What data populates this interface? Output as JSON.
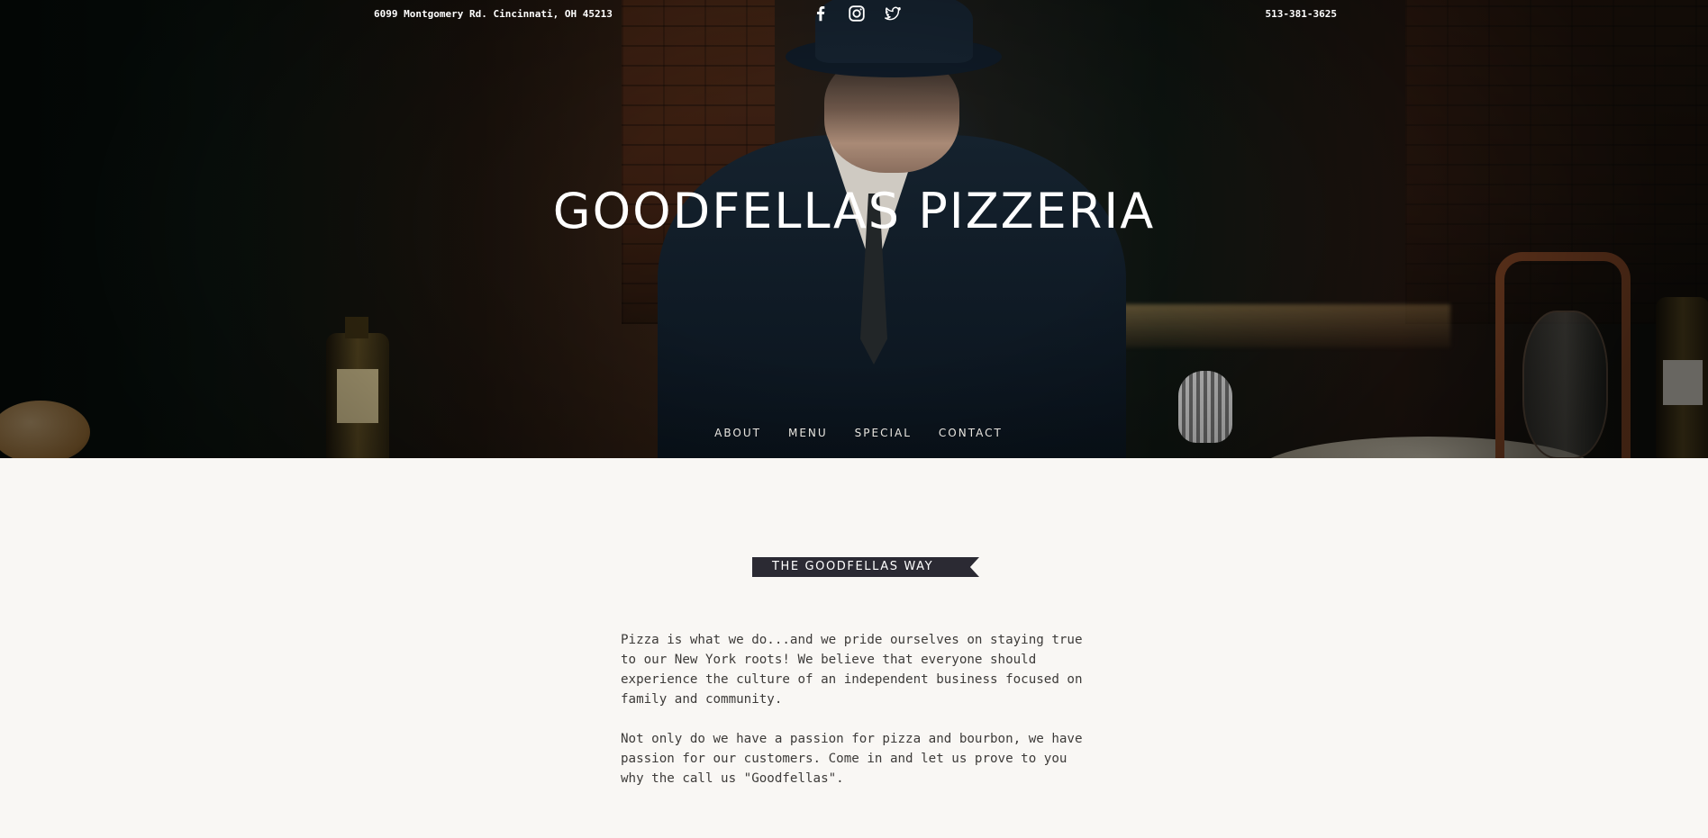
{
  "topbar": {
    "address": "6099 Montgomery Rd. Cincinnati, OH 45213",
    "phone": "513-381-3625",
    "social": [
      {
        "icon": "facebook-icon"
      },
      {
        "icon": "instagram-icon"
      },
      {
        "icon": "twitter-icon"
      }
    ]
  },
  "hero": {
    "title": "GOODFELLAS PIZZERIA"
  },
  "nav": {
    "items": [
      {
        "label": "ABOUT"
      },
      {
        "label": "MENU"
      },
      {
        "label": "SPECIAL"
      },
      {
        "label": "CONTACT"
      }
    ]
  },
  "about": {
    "ribbon": "THE GOODFELLAS WAY",
    "paragraphs": [
      "Pizza is what we do...and we pride ourselves on staying true to our New York roots! We believe that everyone should experience the culture of an independent business focused on family and community.",
      "Not only do we have a passion for pizza and bourbon, we have passion for our customers. Come in and let us prove to you why the call us \"Goodfellas\"."
    ]
  },
  "colors": {
    "background": "#f9f7f4",
    "ribbon": "#2b2a33",
    "text": "#3d3b39",
    "hero_text": "#ffffff"
  }
}
